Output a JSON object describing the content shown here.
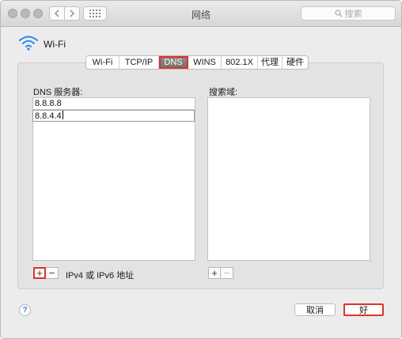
{
  "window": {
    "title": "网络",
    "search_placeholder": "搜索"
  },
  "header": {
    "service_name": "Wi-Fi"
  },
  "tabs": [
    {
      "label": "Wi-Fi",
      "active": false
    },
    {
      "label": "TCP/IP",
      "active": false
    },
    {
      "label": "DNS",
      "active": true
    },
    {
      "label": "WINS",
      "active": false
    },
    {
      "label": "802.1X",
      "active": false
    },
    {
      "label": "代理",
      "active": false
    },
    {
      "label": "硬件",
      "active": false
    }
  ],
  "dns": {
    "label": "DNS 服务器:",
    "servers": [
      "8.8.8.8",
      "8.8.4.4"
    ],
    "add_label": "+",
    "remove_label": "−",
    "hint": "IPv4 或 IPv6 地址"
  },
  "search_domains": {
    "label": "搜索域:",
    "items": [],
    "add_label": "+",
    "remove_label": "−"
  },
  "footer": {
    "help_label": "?",
    "cancel_label": "取消",
    "ok_label": "好"
  },
  "colors": {
    "highlight": "#e0312a",
    "active_tab": "#7a7a7a"
  }
}
